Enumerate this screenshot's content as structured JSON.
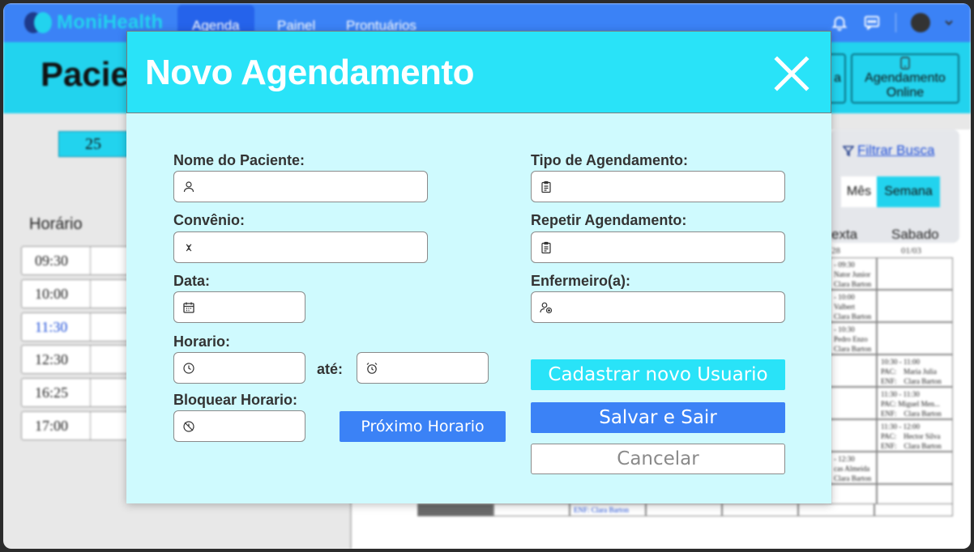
{
  "app": {
    "brand": "MoniHealth",
    "nav_tabs": [
      "Agenda",
      "Painel",
      "Prontuários"
    ],
    "page_title": "Pacie",
    "header_btn_partial": "a",
    "header_btn_online": "Agendamento Online",
    "sidebar_date": "25",
    "horario_label": "Horário",
    "times": [
      "09:30",
      "10:00",
      "11:30",
      "12:30",
      "16:25",
      "17:00"
    ],
    "filter_link": "Filtrar Busca",
    "view_mes": "Mês",
    "view_semana": "Semana",
    "col_sexta": "exta",
    "col_sexta_date": "28",
    "col_sabado": "Sabado",
    "col_sabado_date": "01/03",
    "sexta_cells": [
      "- 09:30\nNator Junior\nClara Barton",
      "- 10:00\nValbert\nClara Barton",
      "- 10:30\nPedro Enzo\nClara Barton",
      "- 12:30\ncas Almeida\nClara Barton"
    ],
    "sabado_cells": [
      "10:30 - 11:00\nPAC:    Maria Julia\nENF:    Clara Barton",
      "11:30 - 11:30\nPAC: Miguel Men...\nENF:    Clara Barton",
      "11:30 - 12:00\nPAC:    Hector Silva\nENF:    Clara Barton"
    ],
    "bottom_cell": "ENF:    Clara Barton"
  },
  "modal": {
    "title": "Novo Agendamento",
    "labels": {
      "nome": "Nome do Paciente:",
      "convenio": "Convênio:",
      "data": "Data:",
      "horario": "Horario:",
      "ate": "até:",
      "bloquear": "Bloquear Horario:",
      "tipo": "Tipo de Agendamento:",
      "repetir": "Repetir Agendamento:",
      "enfermeiro": "Enfermeiro(a):"
    },
    "values": {
      "nome": "",
      "convenio": "",
      "data": "",
      "horario_inicio": "",
      "horario_fim": "",
      "bloquear": "",
      "tipo": "",
      "repetir": "",
      "enfermeiro": ""
    },
    "buttons": {
      "proximo": "Próximo Horario",
      "cadastrar": "Cadastrar novo Usuario",
      "salvar": "Salvar e Sair",
      "cancelar": "Cancelar"
    }
  },
  "colors": {
    "primary": "#3b82f6",
    "accent": "#29e3f8",
    "modal_bg": "#cffafe"
  }
}
